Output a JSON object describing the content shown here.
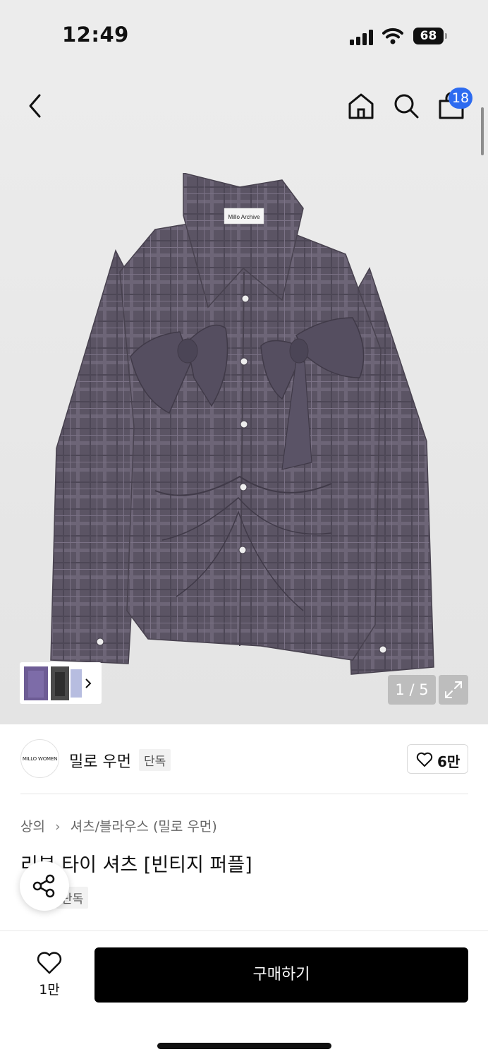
{
  "status_bar": {
    "time": "12:49",
    "battery": "68"
  },
  "header": {
    "back_icon": "chevron-left-icon",
    "home_icon": "home-icon",
    "search_icon": "search-icon",
    "cart_icon": "shopping-bag-icon",
    "cart_count": "18"
  },
  "gallery": {
    "counter": "1 / 5",
    "shirt_label": "Millo Archive",
    "expand_icon": "expand-icon",
    "thumbnail_arrow_icon": "chevron-right-icon"
  },
  "brand": {
    "logo_text": "MILLO WOMEN",
    "name": "밀로 우먼",
    "tag": "단독",
    "like_count": "6만"
  },
  "product": {
    "breadcrumb": [
      "상의",
      "셔츠/블라우스 (밀로 우먼)"
    ],
    "title": "리본 타이 셔츠 [빈티지 퍼플]",
    "tag": "단독"
  },
  "bottom_bar": {
    "wish_count": "1만",
    "buy_label": "구매하기"
  },
  "colors": {
    "badge": "#2d6bf0",
    "buy_button": "#000000",
    "shirt": "#5b5464",
    "gallery_bg": "#ececec"
  }
}
